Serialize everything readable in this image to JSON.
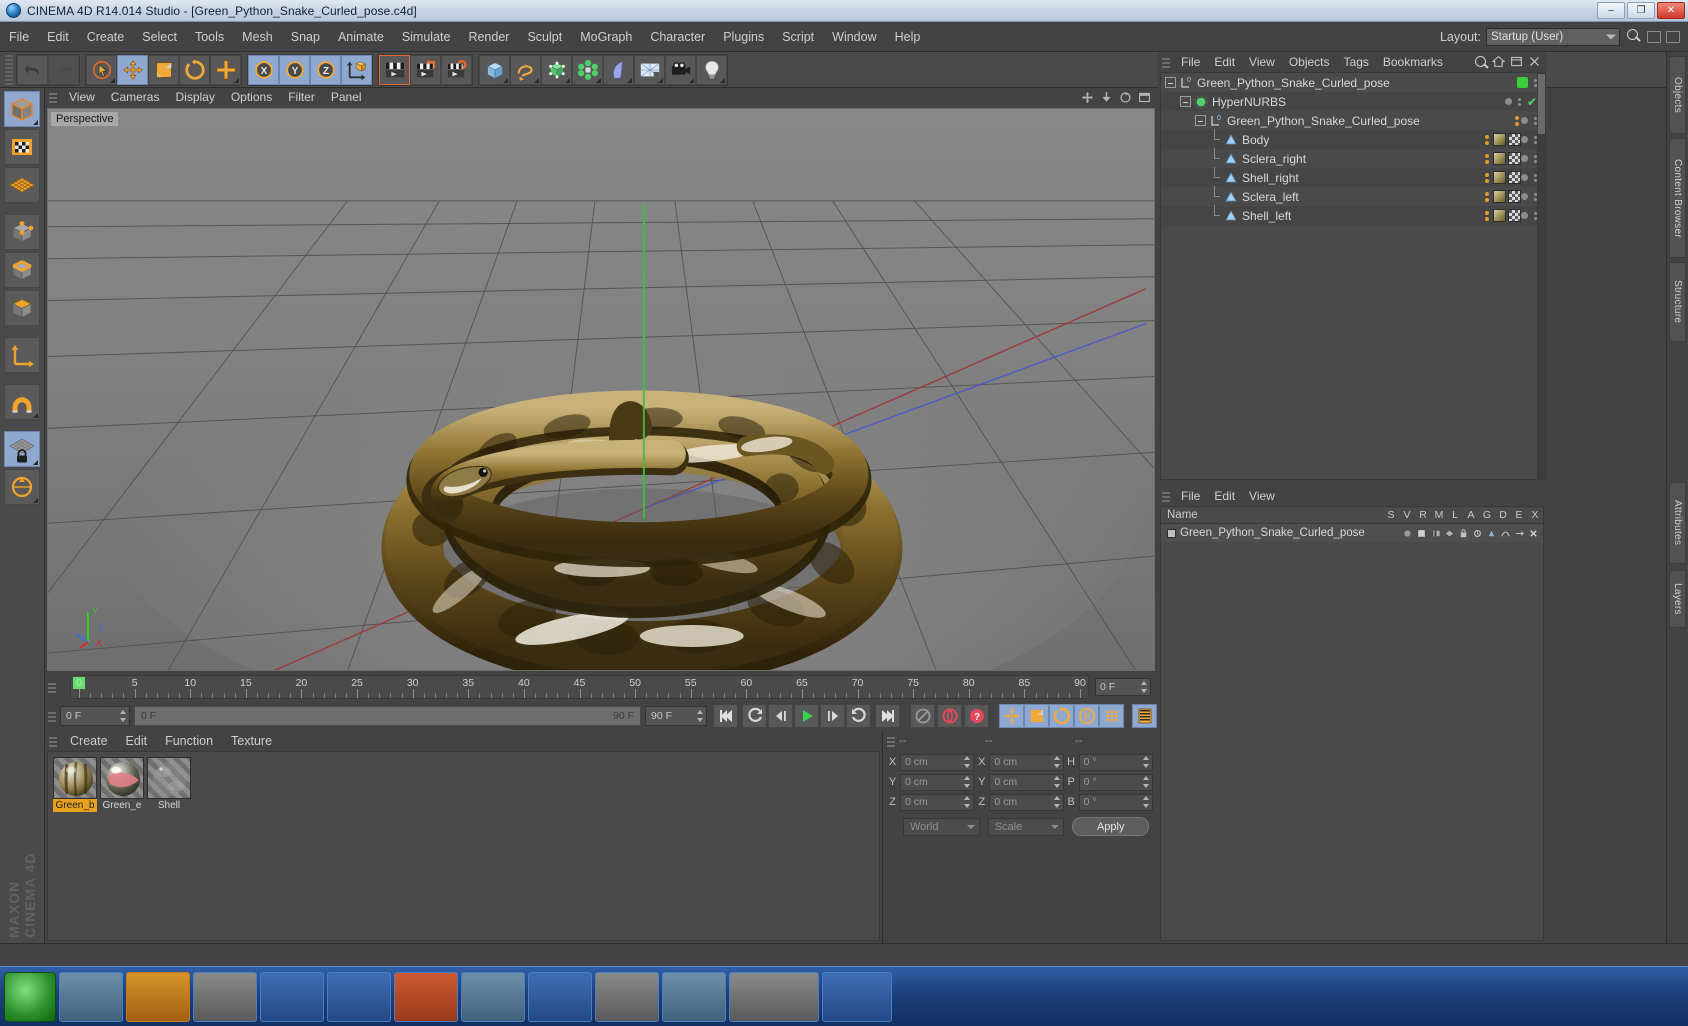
{
  "window": {
    "title": "CINEMA 4D R14.014 Studio - [Green_Python_Snake_Curled_pose.c4d]",
    "minimize": "–",
    "maximize": "❐",
    "close": "✕"
  },
  "menubar": {
    "items": [
      "File",
      "Edit",
      "Create",
      "Select",
      "Tools",
      "Mesh",
      "Snap",
      "Animate",
      "Simulate",
      "Render",
      "Sculpt",
      "MoGraph",
      "Character",
      "Plugins",
      "Script",
      "Window",
      "Help"
    ],
    "layout_label": "Layout:",
    "layout_value": "Startup (User)"
  },
  "toolbar": {
    "groups": [
      {
        "name": "history",
        "buttons": [
          {
            "name": "undo-button",
            "icon": "undo-icon",
            "state": "normal"
          },
          {
            "name": "redo-button",
            "icon": "redo-icon",
            "state": "disabled"
          }
        ]
      },
      {
        "name": "transform",
        "buttons": [
          {
            "name": "select-tool",
            "icon": "cursor-select-icon",
            "state": "normal"
          },
          {
            "name": "move-tool",
            "icon": "move-icon",
            "state": "selected"
          },
          {
            "name": "scale-tool",
            "icon": "scale-icon",
            "state": "normal"
          },
          {
            "name": "rotate-tool",
            "icon": "rotate-icon",
            "state": "normal"
          },
          {
            "name": "add-tool",
            "icon": "plus-icon",
            "state": "normal"
          }
        ]
      },
      {
        "name": "axis-lock",
        "buttons": [
          {
            "name": "lock-x-axis",
            "icon": "x-axis-icon",
            "state": "selected"
          },
          {
            "name": "lock-y-axis",
            "icon": "y-axis-icon",
            "state": "selected"
          },
          {
            "name": "lock-z-axis",
            "icon": "z-axis-icon",
            "state": "selected"
          },
          {
            "name": "world-object-coord",
            "icon": "world-axis-icon",
            "state": "selected"
          }
        ]
      },
      {
        "name": "render",
        "buttons": [
          {
            "name": "render-view-button",
            "icon": "render-view-icon",
            "state": "normal"
          },
          {
            "name": "render-to-picture-viewer-button",
            "icon": "render-picture-icon",
            "state": "normal"
          },
          {
            "name": "render-settings-button",
            "icon": "render-settings-icon",
            "state": "normal"
          }
        ]
      },
      {
        "name": "create",
        "buttons": [
          {
            "name": "cube-primitive-button",
            "icon": "cube-icon",
            "state": "normal"
          },
          {
            "name": "spline-button",
            "icon": "spline-icon",
            "state": "normal"
          },
          {
            "name": "nurbs-button",
            "icon": "nurbs-icon",
            "state": "normal"
          },
          {
            "name": "array-button",
            "icon": "array-icon",
            "state": "normal"
          },
          {
            "name": "deformer-button",
            "icon": "bend-deformer-icon",
            "state": "normal"
          },
          {
            "name": "floor-environment-button",
            "icon": "floor-icon",
            "state": "normal"
          },
          {
            "name": "camera-button",
            "icon": "camera-icon",
            "state": "normal"
          },
          {
            "name": "light-button",
            "icon": "light-bulb-icon",
            "state": "normal"
          }
        ]
      }
    ]
  },
  "left_tools": [
    {
      "name": "model-mode",
      "icon": "model-cube-icon",
      "state": "selected"
    },
    {
      "name": "texture-mode",
      "icon": "texture-checker-icon",
      "state": "normal"
    },
    {
      "name": "polygon-grid-mode",
      "icon": "grid-mesh-icon",
      "state": "normal"
    },
    {
      "name": "points-mode",
      "icon": "points-cube-icon",
      "state": "normal"
    },
    {
      "name": "edges-mode",
      "icon": "edges-cube-icon",
      "state": "normal"
    },
    {
      "name": "polygons-mode",
      "icon": "polygons-cube-icon",
      "state": "normal"
    },
    {
      "name": "axis-mode",
      "icon": "axis-arrows-icon",
      "state": "normal"
    },
    {
      "name": "enable-snap",
      "icon": "magnet-icon",
      "state": "normal"
    },
    {
      "name": "lock-workplane",
      "icon": "workplane-lock-icon",
      "state": "selected"
    },
    {
      "name": "workplane-tool",
      "icon": "workplane-circle-icon",
      "state": "normal"
    }
  ],
  "viewport": {
    "menu": [
      "View",
      "Cameras",
      "Display",
      "Options",
      "Filter",
      "Panel"
    ],
    "label": "Perspective",
    "axis_labels": {
      "x": "X",
      "y": "Y",
      "z": "Z"
    },
    "colors": {
      "x": "#e02424",
      "y": "#2ecf2e",
      "z": "#3a6ee0",
      "background": "#7d7d7d"
    }
  },
  "timeline": {
    "ruler_start": 0,
    "ruler_end": 90,
    "major_ticks": [
      0,
      5,
      10,
      15,
      20,
      25,
      30,
      35,
      40,
      45,
      50,
      55,
      60,
      65,
      70,
      75,
      80,
      85,
      90
    ],
    "current_frame_field": "0 F",
    "playhead_frame": 0,
    "start_field": "0 F",
    "range_start": "0 F",
    "range_end": "90 F",
    "end_field": "90 F"
  },
  "transport": {
    "buttons": [
      {
        "name": "go-to-start-button",
        "icon": "skip-start-icon"
      },
      {
        "name": "go-back-keyframe-button",
        "icon": "prev-key-icon"
      },
      {
        "name": "play-backwards-button",
        "icon": "play-back-icon"
      },
      {
        "name": "play-forwards-button",
        "icon": "play-icon"
      },
      {
        "name": "go-forward-frame-button",
        "icon": "next-frame-icon"
      },
      {
        "name": "go-forward-keyframe-button",
        "icon": "next-key-icon"
      },
      {
        "name": "go-to-end-button",
        "icon": "skip-end-icon"
      },
      {
        "name": "autokeying-button",
        "icon": "autokey-icon"
      },
      {
        "name": "record-active-objects-button",
        "icon": "record-icon"
      },
      {
        "name": "keyframe-selection-button",
        "icon": "question-key-icon"
      },
      {
        "name": "position-key-button",
        "icon": "position-key-icon"
      },
      {
        "name": "scale-key-button",
        "icon": "scale-key-icon"
      },
      {
        "name": "rotation-key-button",
        "icon": "rotation-key-icon"
      },
      {
        "name": "parameter-key-button",
        "icon": "param-key-icon"
      },
      {
        "name": "point-level-animation-button",
        "icon": "pla-dots-icon"
      },
      {
        "name": "timeline-button",
        "icon": "timeline-film-icon"
      }
    ]
  },
  "material_manager": {
    "menu": [
      "Create",
      "Edit",
      "Function",
      "Texture"
    ],
    "materials": [
      {
        "name": "Green_b",
        "selected": true,
        "swatch": "green-body-material"
      },
      {
        "name": "Green_e",
        "selected": false,
        "swatch": "green-eye-material"
      },
      {
        "name": "Shell",
        "selected": false,
        "swatch": "shell-material"
      }
    ]
  },
  "coordinates": {
    "headers": [
      "--",
      "--",
      "--"
    ],
    "rows": [
      {
        "pos_label": "X",
        "pos_value": "0 cm",
        "size_label": "X",
        "size_value": "0 cm",
        "rot_label": "H",
        "rot_value": "0 °"
      },
      {
        "pos_label": "Y",
        "pos_value": "0 cm",
        "size_label": "Y",
        "size_value": "0 cm",
        "rot_label": "P",
        "rot_value": "0 °"
      },
      {
        "pos_label": "Z",
        "pos_value": "0 cm",
        "size_label": "Z",
        "size_value": "0 cm",
        "rot_label": "B",
        "rot_value": "0 °"
      }
    ],
    "system_select": "World",
    "mode_select": "Scale",
    "apply_button": "Apply"
  },
  "object_manager": {
    "menu": [
      "File",
      "Edit",
      "View",
      "Objects",
      "Tags",
      "Bookmarks"
    ],
    "rows": [
      {
        "label": "Green_Python_Snake_Curled_pose",
        "indent": 0,
        "icon": "null-object-icon",
        "expander": "minus",
        "green_swatch": true,
        "check": false,
        "tags": []
      },
      {
        "label": "HyperNURBS",
        "indent": 1,
        "icon": "hypernurbs-icon",
        "expander": "minus",
        "green_swatch": false,
        "check": true,
        "tags": []
      },
      {
        "label": "Green_Python_Snake_Curled_pose",
        "indent": 2,
        "icon": "null-object-icon",
        "expander": "minus",
        "green_swatch": false,
        "check": false,
        "tags": [
          "dots"
        ]
      },
      {
        "label": "Body",
        "indent": 3,
        "icon": "polygon-object-icon",
        "expander": "none",
        "green_swatch": false,
        "check": false,
        "tags": [
          "dots",
          "texture",
          "checker"
        ]
      },
      {
        "label": "Sclera_right",
        "indent": 3,
        "icon": "polygon-object-icon",
        "expander": "none",
        "green_swatch": false,
        "check": false,
        "tags": [
          "dots",
          "texture",
          "checker"
        ]
      },
      {
        "label": "Shell_right",
        "indent": 3,
        "icon": "polygon-object-icon",
        "expander": "none",
        "green_swatch": false,
        "check": false,
        "tags": [
          "dots",
          "texture",
          "checker"
        ]
      },
      {
        "label": "Sclera_left",
        "indent": 3,
        "icon": "polygon-object-icon",
        "expander": "none",
        "green_swatch": false,
        "check": false,
        "tags": [
          "dots",
          "texture",
          "checker"
        ]
      },
      {
        "label": "Shell_left",
        "indent": 3,
        "icon": "polygon-object-icon",
        "expander": "none",
        "green_swatch": false,
        "check": false,
        "tags": [
          "dots",
          "texture",
          "checker"
        ]
      }
    ]
  },
  "layer_panel": {
    "menu": [
      "File",
      "Edit",
      "View"
    ],
    "columns": [
      "Name",
      "S",
      "V",
      "R",
      "M",
      "L",
      "A",
      "G",
      "D",
      "E",
      "X"
    ],
    "rows": [
      {
        "label": "Green_Python_Snake_Curled_pose"
      }
    ]
  },
  "right_dock": {
    "tabs": [
      "Objects",
      "Content Browser",
      "Structure",
      "Attributes",
      "Layers"
    ]
  },
  "watermark": "MAXON CINEMA 4D"
}
